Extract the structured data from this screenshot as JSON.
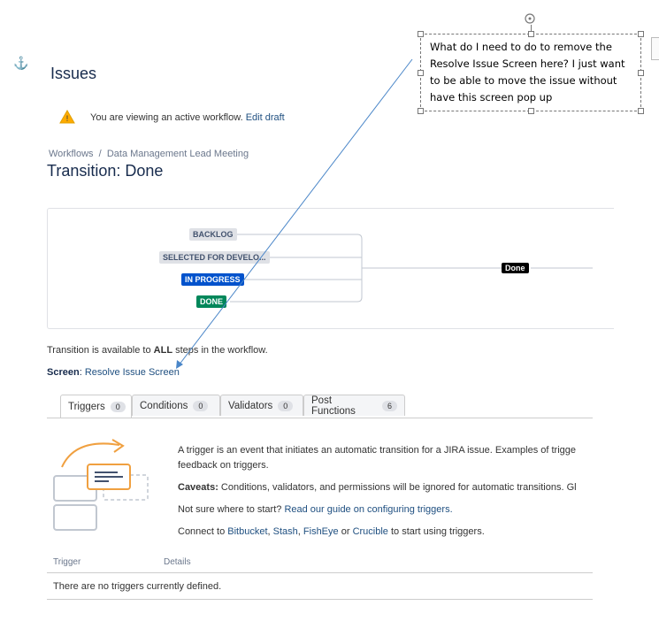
{
  "page": {
    "title": "Issues",
    "warning_text": "You are viewing an active workflow.",
    "edit_draft_link": "Edit draft",
    "breadcrumb": {
      "workflows": "Workflows",
      "separator": "/",
      "workflow_name": "Data Management Lead Meeting"
    },
    "transition_title": "Transition: Done"
  },
  "diagram": {
    "statuses": [
      {
        "label": "BACKLOG",
        "style": "gray"
      },
      {
        "label": "SELECTED FOR DEVELO...",
        "style": "gray"
      },
      {
        "label": "IN PROGRESS",
        "style": "blue"
      },
      {
        "label": "DONE",
        "style": "green"
      }
    ],
    "target": "Done"
  },
  "availability": {
    "prefix": "Transition is available to ",
    "bold": "ALL",
    "suffix": " steps in the workflow."
  },
  "screen": {
    "label": "Screen",
    "colon": ":",
    "value": "Resolve Issue Screen"
  },
  "tabs": [
    {
      "label": "Triggers",
      "count": "0",
      "active": true
    },
    {
      "label": "Conditions",
      "count": "0",
      "active": false
    },
    {
      "label": "Validators",
      "count": "0",
      "active": false
    },
    {
      "label": "Post Functions",
      "count": "6",
      "active": false
    }
  ],
  "triggers": {
    "intro": "A trigger is an event that initiates an automatic transition for a JIRA issue. Examples of trigge",
    "feedback_link": "feedback on triggers.",
    "caveats_label": "Caveats:",
    "caveats_text": " Conditions, validators, and permissions will be ignored for automatic transitions. Gl",
    "not_sure": "Not sure where to start? ",
    "guide_link": "Read our guide on configuring triggers.",
    "connect_prefix": "Connect to ",
    "bitbucket": "Bitbucket",
    "comma1": ", ",
    "stash": "Stash",
    "comma2": ", ",
    "fisheye": "FishEye",
    "or": " or ",
    "crucible": "Crucible",
    "connect_suffix": " to start using triggers."
  },
  "table": {
    "col_trigger": "Trigger",
    "col_details": "Details",
    "empty": "There are no triggers currently defined."
  },
  "annotation": {
    "text": "What do I need to do to remove the Resolve Issue Screen here?   I just want to be able to move the issue without have this screen pop up"
  },
  "colors": {
    "link": "#205081",
    "in_progress": "#0052cc",
    "done": "#00875a",
    "arrow": "#4a86c8"
  }
}
